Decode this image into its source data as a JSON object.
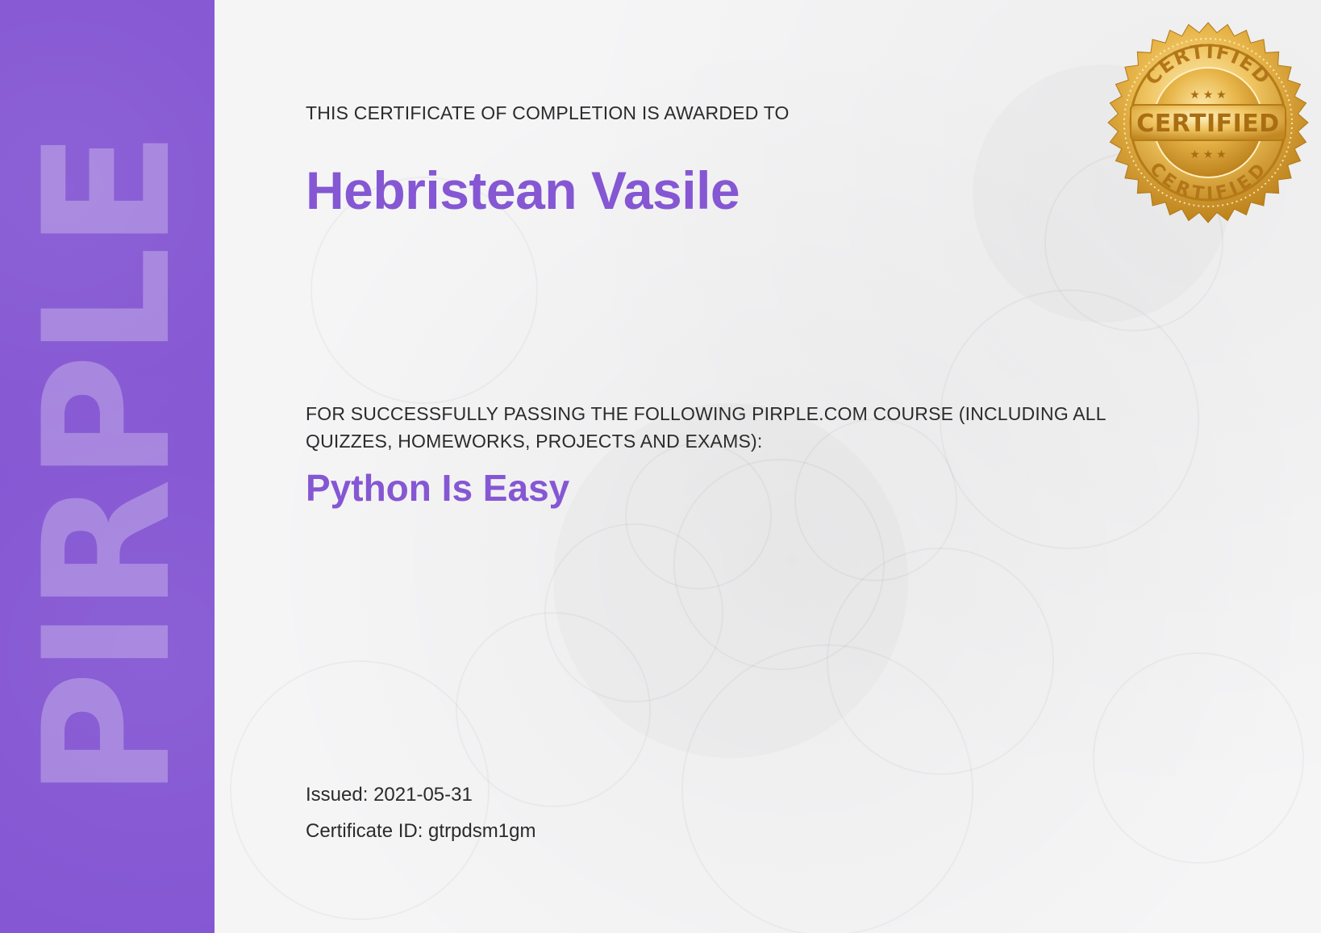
{
  "sidebar": {
    "brand_text": "PIRPLE"
  },
  "certificate": {
    "awarded_to_label": "THIS CERTIFICATE OF COMPLETION IS AWARDED TO",
    "recipient_name": "Hebristean Vasile",
    "course_intro": "FOR SUCCESSFULLY PASSING THE FOLLOWING PIRPLE.COM COURSE (INCLUDING ALL QUIZZES, HOMEWORKS, PROJECTS AND EXAMS):",
    "course_name": "Python Is Easy",
    "issued_label": "Issued:",
    "issued_date": "2021-05-31",
    "certificate_id_label": "Certificate ID:",
    "certificate_id": "gtrpdsm1gm"
  },
  "seal": {
    "icon": "certified-seal-icon",
    "top_text": "CERTIFIED",
    "center_text": "CERTIFIED",
    "bottom_text": "CERTIFIED"
  },
  "colors": {
    "accent": "#8557d3",
    "gold": "#d9a53b",
    "text": "#2b2b2b",
    "background": "#f5f5f6"
  }
}
